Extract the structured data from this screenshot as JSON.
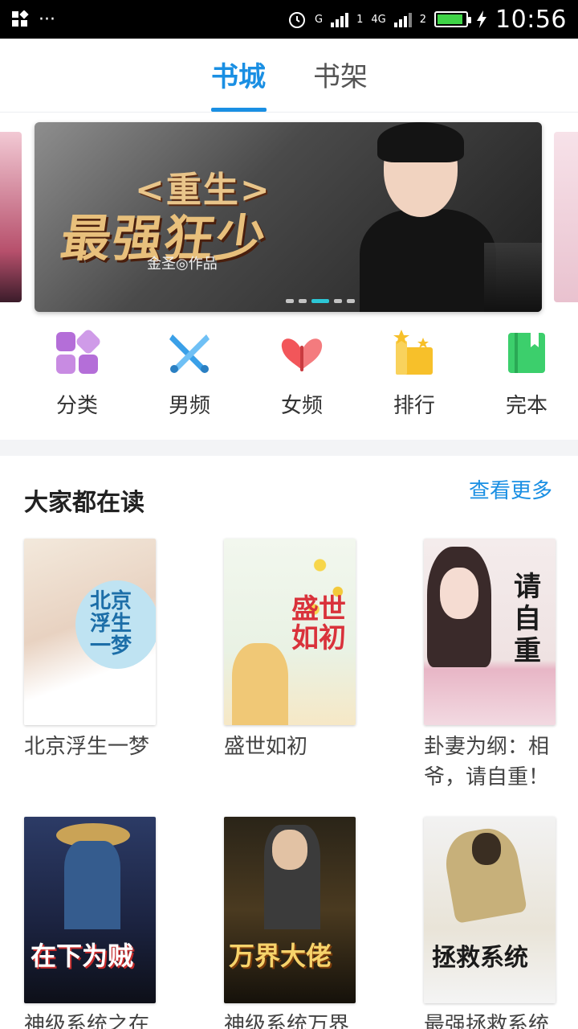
{
  "status_bar": {
    "time": "10:56",
    "network_label": "G",
    "network_4g": "4G",
    "sim1": "1",
    "sim2": "2",
    "battery_level": 0.9
  },
  "tabs": [
    {
      "label": "书城",
      "active": true
    },
    {
      "label": "书架",
      "active": false
    }
  ],
  "banner": {
    "title_sub": "<重生>",
    "title": "最强狂少",
    "author": "金圣◎作品",
    "dots": 5,
    "active_dot": 3
  },
  "categories": [
    {
      "label": "分类",
      "icon": "grid-category-icon",
      "color": "#b46ed8"
    },
    {
      "label": "男频",
      "icon": "crossed-swords-icon",
      "color": "#3aa0e8"
    },
    {
      "label": "女频",
      "icon": "butterfly-icon",
      "color": "#f2565a"
    },
    {
      "label": "排行",
      "icon": "ranking-stars-icon",
      "color": "#f7c02a"
    },
    {
      "label": "完本",
      "icon": "book-complete-icon",
      "color": "#3ccf6c"
    }
  ],
  "section": {
    "title": "大家都在读",
    "more_label": "查看更多"
  },
  "books": [
    {
      "title": "北京浮生一梦",
      "cover_text": "北京浮生一梦"
    },
    {
      "title": "盛世如初",
      "cover_text": "盛世如初"
    },
    {
      "title": "卦妻为纲：相爷，请自重！",
      "cover_text": "请自重"
    },
    {
      "title": "神级系统之在",
      "cover_text": "在下为贼"
    },
    {
      "title": "神级系统万界",
      "cover_text": "万界大佬"
    },
    {
      "title": "最强拯救系统",
      "cover_text": "拯救系统"
    }
  ],
  "colors": {
    "accent": "#1a8fe3",
    "active_dot": "#2cc7d6"
  }
}
